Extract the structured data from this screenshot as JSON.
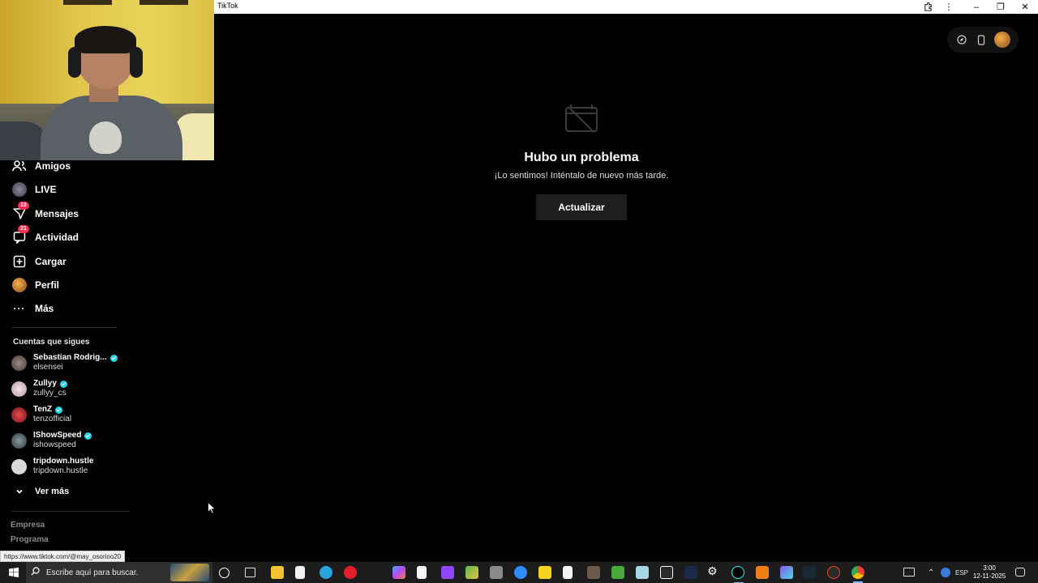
{
  "window": {
    "title": "TikTok",
    "controls": [
      "extensions-icon",
      "more-icon",
      "minimize-icon",
      "restore-icon",
      "close-icon"
    ]
  },
  "sidebar": {
    "nav": [
      {
        "id": "amigos",
        "label": "Amigos",
        "icon": "friends-icon"
      },
      {
        "id": "live",
        "label": "LIVE",
        "icon": "live-icon"
      },
      {
        "id": "mensajes",
        "label": "Mensajes",
        "icon": "messages-icon",
        "badge": "19"
      },
      {
        "id": "actividad",
        "label": "Actividad",
        "icon": "activity-icon",
        "badge": "21"
      },
      {
        "id": "cargar",
        "label": "Cargar",
        "icon": "upload-icon"
      },
      {
        "id": "perfil",
        "label": "Perfil",
        "icon": "profile-avatar"
      },
      {
        "id": "mas",
        "label": "Más",
        "icon": "more-dots-icon"
      }
    ],
    "following_title": "Cuentas que sigues",
    "following": [
      {
        "name": "Sebastian Rodrig...",
        "handle": "elsensei",
        "verified": true,
        "color": "#6b5a55"
      },
      {
        "name": "Zullyy",
        "handle": "zullyy_cs",
        "verified": true,
        "color": "#e8d6dc"
      },
      {
        "name": "TenZ",
        "handle": "tenzofficial",
        "verified": true,
        "color": "#c8252c"
      },
      {
        "name": "IShowSpeed",
        "handle": "ishowspeed",
        "verified": true,
        "color": "#5a6a6e"
      },
      {
        "name": "tripdown.hustle",
        "handle": "tripdown.hustle",
        "verified": false,
        "color": "#d9d9d9"
      }
    ],
    "see_more": "Ver más",
    "footer": [
      "Empresa",
      "Programa"
    ]
  },
  "error": {
    "title": "Hubo un problema",
    "subtitle": "¡Lo sentimos! Inténtalo de nuevo más tarde.",
    "button": "Actualizar"
  },
  "status_url": "https://www.tiktok.com/@may_osorioo20",
  "taskbar": {
    "search_placeholder": "Escribe aquí para buscar.",
    "language": "ESP",
    "time": "3:00",
    "date": "12-11-2025"
  },
  "colors": {
    "accent": "#fe2c55",
    "verified": "#20d5ec",
    "background": "#000000"
  }
}
